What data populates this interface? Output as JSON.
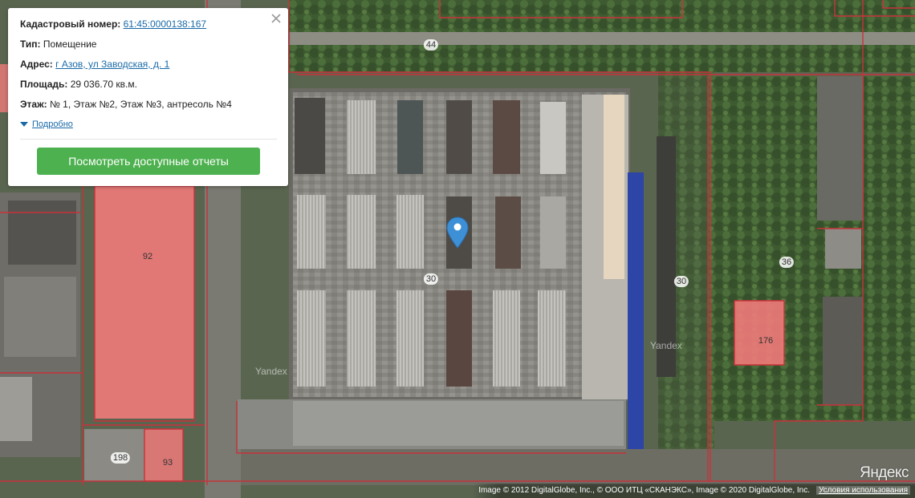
{
  "popup": {
    "cadastral_label": "Кадастровый номер:",
    "cadastral_value": "61:45:0000138:167",
    "type_label": "Тип:",
    "type_value": "Помещение",
    "address_label": "Адрес:",
    "address_value": "г Азов, ул Заводская, д. 1",
    "area_label": "Площадь:",
    "area_value": "29 036.70 кв.м.",
    "floor_label": "Этаж:",
    "floor_value": "№ 1, Этаж №2, Этаж №3, антресоль №4",
    "details_toggle": "Подробно",
    "reports_button": "Посмотреть доступные отчеты",
    "close_icon": "close-icon"
  },
  "map": {
    "parcel_labels": {
      "p44": "44",
      "p92": "92",
      "p30a": "30",
      "p30b": "30",
      "p36": "36",
      "p176": "176",
      "p198": "198",
      "p93": "93"
    },
    "watermarks": {
      "w1": "Yandex",
      "w2": "Yandex"
    },
    "logo": "Яндекс",
    "copyright": "Image © 2012 DigitalGlobe, Inc., © ООО ИТЦ «СКАНЭКС», Image © 2020 DigitalGlobe, Inc.",
    "terms_link": "Условия использования",
    "pin_icon": "map-pin-icon",
    "colors": {
      "parcel_border": "#c8323a",
      "highlight_fill": "#f07a7a",
      "button_green": "#4db14f",
      "link_blue": "#1a6aa8",
      "pin_blue": "#3d8fd6"
    }
  }
}
